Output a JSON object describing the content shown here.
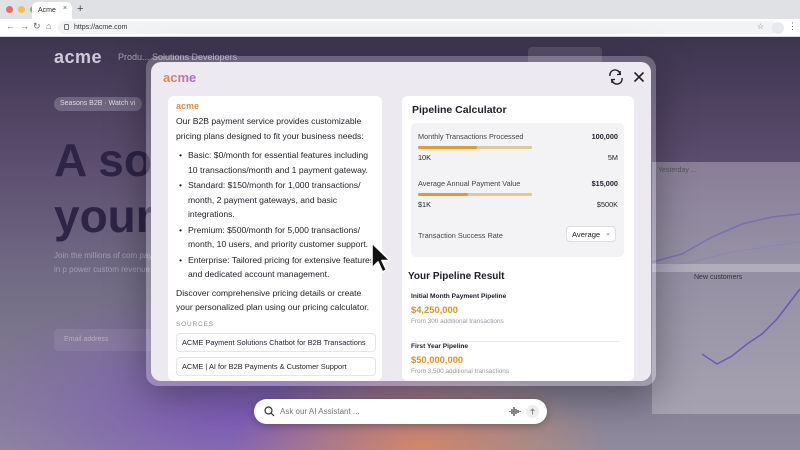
{
  "browser": {
    "tab_title": "Acme",
    "tab_close": "×",
    "new_tab": "+",
    "url": "https://acme.com",
    "dot_colors": [
      "#ed6a5e",
      "#f5bf4f",
      "#62c554"
    ]
  },
  "background_site": {
    "logo": "acme",
    "nav_text": "Produ...     Solutions     Developers",
    "chip": "Seasons B2B · Watch vi",
    "headline_line1": "A so",
    "headline_line2": "your",
    "paragraph": "Join the millions of com payments online and in p power custom revenue m business.",
    "email_placeholder": "Email address",
    "card1_label": "Yesterday ...",
    "card2_label": "New customers"
  },
  "modal": {
    "logo": "acme",
    "chat": {
      "logo": "acme",
      "intro": "Our B2B payment service provides customizable pricing plans designed to fit your business needs:",
      "plans": [
        "Basic: $0/month for essential features including 10 transactions/month and 1 payment gateway.",
        "Standard: $150/month for 1,000 transactions/ month, 2 payment gateways, and basic integrations.",
        "Premium: $500/month for 5,000 transactions/ month, 10 users, and priority customer support.",
        "Enterprise: Tailored pricing for extensive features and dedicated account management."
      ],
      "outro": "Discover comprehensive pricing details or create your personalized plan using our pricing calculator.",
      "sources_label": "SOURCES",
      "sources": [
        "ACME Payment Solutions Chatbot for B2B Transactions",
        "ACME | AI for B2B Payments & Customer Support"
      ]
    },
    "calculator": {
      "title": "Pipeline Calculator",
      "monthly": {
        "label": "Monthly Transactions Processed",
        "value": "100,000",
        "min": "10K",
        "max": "5M",
        "fill_pct": 52
      },
      "annual": {
        "label": "Average Annual Payment Value",
        "value": "$15,000",
        "min": "$1K",
        "max": "$500K",
        "fill_pct": 44
      },
      "success_rate": {
        "label": "Transaction Success Rate",
        "selected": "Average"
      },
      "result_title": "Your Pipeline Result",
      "results": [
        {
          "label": "Initial Month Payment Pipeline",
          "value": "$4,250,000",
          "sub": "From 300 additional transactions"
        },
        {
          "label": "First Year Pipeline",
          "value": "$50,000,000",
          "sub": "From 3,500 additional transactions"
        }
      ]
    }
  },
  "ai_search": {
    "placeholder": "Ask our AI Assistant ..."
  },
  "colors": {
    "accent_orange": "#e59b2b",
    "result_gold": "#d79326",
    "logo_gradient_start": "#e38a3e",
    "logo_gradient_end": "#a569d8"
  },
  "icons": [
    "lock-icon",
    "star-icon",
    "refresh-icon",
    "close-icon",
    "search-icon",
    "waveform-icon",
    "send-icon",
    "chevron-down-icon",
    "cursor-arrow-icon"
  ]
}
